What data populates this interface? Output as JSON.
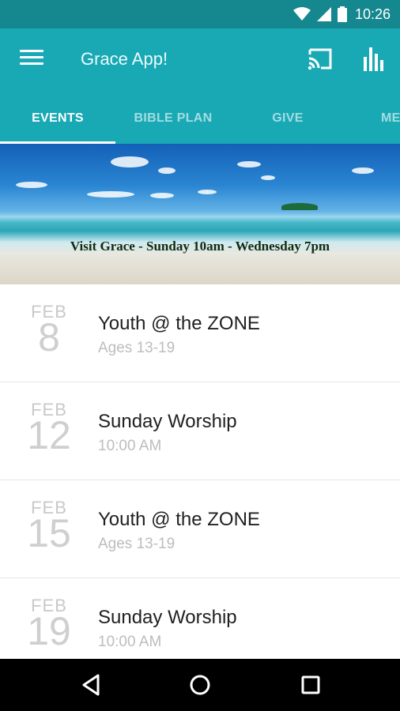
{
  "status_bar": {
    "time": "10:26",
    "icons": [
      "wifi-icon",
      "signal-icon",
      "battery-icon"
    ]
  },
  "app_bar": {
    "title": "Grace App!",
    "icons": [
      "menu-icon",
      "cast-icon",
      "bar-chart-icon"
    ]
  },
  "tabs": [
    {
      "label": "EVENTS",
      "active": true
    },
    {
      "label": "BIBLE PLAN",
      "active": false
    },
    {
      "label": "GIVE",
      "active": false
    },
    {
      "label": "ME",
      "active": false
    }
  ],
  "banner": {
    "caption": "Visit Grace - Sunday 10am - Wednesday 7pm"
  },
  "events": [
    {
      "month": "FEB",
      "day": "8",
      "title": "Youth @ the ZONE",
      "subtitle": "Ages 13-19"
    },
    {
      "month": "FEB",
      "day": "12",
      "title": "Sunday Worship",
      "subtitle": "10:00 AM"
    },
    {
      "month": "FEB",
      "day": "15",
      "title": "Youth @ the ZONE",
      "subtitle": "Ages 13-19"
    },
    {
      "month": "FEB",
      "day": "19",
      "title": "Sunday Worship",
      "subtitle": "10:00 AM"
    }
  ],
  "nav_bar": {
    "icons": [
      "back-icon",
      "home-icon",
      "recents-icon"
    ]
  },
  "colors": {
    "primary": "#19a9b5",
    "primary_dark": "#15878f",
    "text_primary": "#212121",
    "text_muted": "#bdbdbd"
  }
}
